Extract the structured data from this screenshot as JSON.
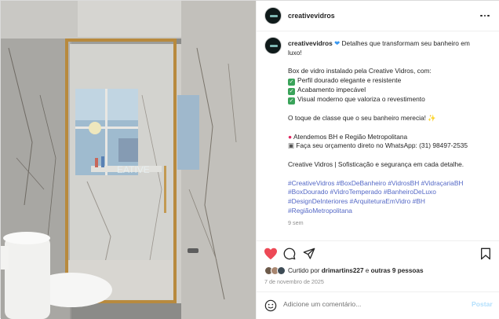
{
  "post": {
    "username": "creativevidros",
    "caption_lines": {
      "l1_rest": "Detalhes que transformam seu banheiro em",
      "l2": "luxo!",
      "l3": "Box de vidro instalado pela Creative Vidros, com:",
      "l4": "Perfil dourado elegante e resistente",
      "l5": "Acabamento impecável",
      "l6": "Visual moderno que valoriza o revestimento",
      "l7": "O toque de classe que o seu banheiro merecia!",
      "l8": "Atendemos BH e Região Metropolitana",
      "l9": "Faça seu orçamento direto no WhatsApp: (31) 98497-2535",
      "l10": "Creative Vidros | Sofisticação e segurança em cada detalhe."
    },
    "hashtags": [
      "#CreativeVidros #BoxDeBanheiro #VidrosBH #VidraçariaBH",
      "#BoxDourado #VidroTemperado #BanheiroDeLuxo",
      "#DesignDeInteriores #ArquiteturaEmVidro #BH",
      "#RegiãoMetropolitana"
    ],
    "time_ago": "9 sem",
    "liked_by_prefix": "Curtido por",
    "liked_by_user": "drimartins227",
    "liked_by_conj": "e",
    "liked_by_others": "outras 9 pessoas",
    "date": "7 de novembro de 2025",
    "photo_watermark": "EATIVE"
  },
  "comment": {
    "placeholder": "Adicione um comentário...",
    "post_label": "Postar"
  },
  "colors": {
    "like_red": "#ed4956",
    "hashtag_blue": "#5468c6",
    "post_button_disabled": "#b2dffc",
    "gold_frame": "#b88a3e"
  },
  "icons": [
    "more-icon",
    "heart-icon",
    "comment-icon",
    "share-icon",
    "bookmark-icon",
    "emoji-icon",
    "blue-heart-emoji",
    "check-emoji",
    "pin-emoji",
    "phone-emoji",
    "sparkles-emoji"
  ]
}
